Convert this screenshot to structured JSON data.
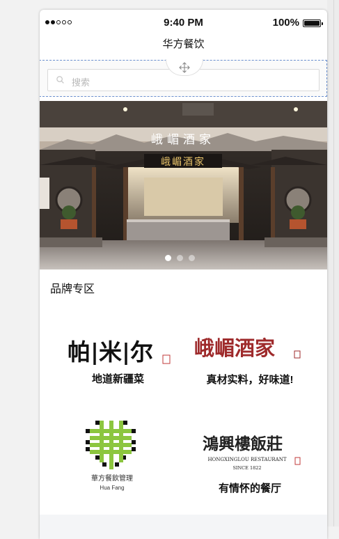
{
  "status_bar": {
    "time": "9:40 PM",
    "battery": "100%"
  },
  "nav": {
    "title": "华方餐饮"
  },
  "search": {
    "placeholder": "搜索"
  },
  "banner": {
    "sign_top": "峨嵋酒家",
    "sign_main": "峨嵋酒家",
    "slide_count": 3,
    "active_slide": 1
  },
  "section": {
    "title": "品牌专区"
  },
  "brands": [
    {
      "logo_text": "帕|米|尔",
      "caption": "地道新疆菜"
    },
    {
      "logo_text": "峨嵋酒家",
      "caption": "真材实料，好味道!"
    },
    {
      "logo_text_cn": "華方餐飲管理",
      "logo_text_en": "Hua Fang",
      "caption": ""
    },
    {
      "logo_text": "鴻興樓飯莊",
      "logo_sub_en": "HONGXINGLOU RESTAURANT",
      "logo_since": "SINCE 1822",
      "caption": "有情怀的餐厅"
    }
  ],
  "colors": {
    "brand_red": "#9e2a2b",
    "huafang_green": "#8cc63f",
    "selection_blue": "#6a8fcf"
  }
}
